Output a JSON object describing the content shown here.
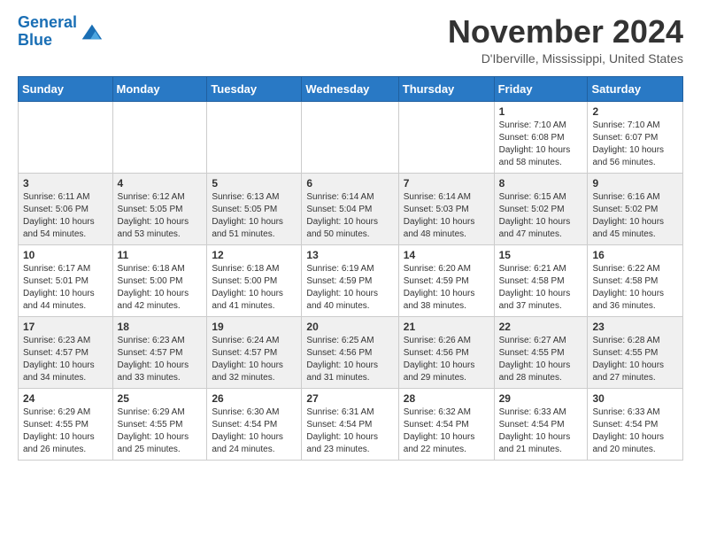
{
  "header": {
    "logo_line1": "General",
    "logo_line2": "Blue",
    "month": "November 2024",
    "location": "D'Iberville, Mississippi, United States"
  },
  "weekdays": [
    "Sunday",
    "Monday",
    "Tuesday",
    "Wednesday",
    "Thursday",
    "Friday",
    "Saturday"
  ],
  "weeks": [
    [
      {
        "day": "",
        "info": ""
      },
      {
        "day": "",
        "info": ""
      },
      {
        "day": "",
        "info": ""
      },
      {
        "day": "",
        "info": ""
      },
      {
        "day": "",
        "info": ""
      },
      {
        "day": "1",
        "info": "Sunrise: 7:10 AM\nSunset: 6:08 PM\nDaylight: 10 hours\nand 58 minutes."
      },
      {
        "day": "2",
        "info": "Sunrise: 7:10 AM\nSunset: 6:07 PM\nDaylight: 10 hours\nand 56 minutes."
      }
    ],
    [
      {
        "day": "3",
        "info": "Sunrise: 6:11 AM\nSunset: 5:06 PM\nDaylight: 10 hours\nand 54 minutes."
      },
      {
        "day": "4",
        "info": "Sunrise: 6:12 AM\nSunset: 5:05 PM\nDaylight: 10 hours\nand 53 minutes."
      },
      {
        "day": "5",
        "info": "Sunrise: 6:13 AM\nSunset: 5:05 PM\nDaylight: 10 hours\nand 51 minutes."
      },
      {
        "day": "6",
        "info": "Sunrise: 6:14 AM\nSunset: 5:04 PM\nDaylight: 10 hours\nand 50 minutes."
      },
      {
        "day": "7",
        "info": "Sunrise: 6:14 AM\nSunset: 5:03 PM\nDaylight: 10 hours\nand 48 minutes."
      },
      {
        "day": "8",
        "info": "Sunrise: 6:15 AM\nSunset: 5:02 PM\nDaylight: 10 hours\nand 47 minutes."
      },
      {
        "day": "9",
        "info": "Sunrise: 6:16 AM\nSunset: 5:02 PM\nDaylight: 10 hours\nand 45 minutes."
      }
    ],
    [
      {
        "day": "10",
        "info": "Sunrise: 6:17 AM\nSunset: 5:01 PM\nDaylight: 10 hours\nand 44 minutes."
      },
      {
        "day": "11",
        "info": "Sunrise: 6:18 AM\nSunset: 5:00 PM\nDaylight: 10 hours\nand 42 minutes."
      },
      {
        "day": "12",
        "info": "Sunrise: 6:18 AM\nSunset: 5:00 PM\nDaylight: 10 hours\nand 41 minutes."
      },
      {
        "day": "13",
        "info": "Sunrise: 6:19 AM\nSunset: 4:59 PM\nDaylight: 10 hours\nand 40 minutes."
      },
      {
        "day": "14",
        "info": "Sunrise: 6:20 AM\nSunset: 4:59 PM\nDaylight: 10 hours\nand 38 minutes."
      },
      {
        "day": "15",
        "info": "Sunrise: 6:21 AM\nSunset: 4:58 PM\nDaylight: 10 hours\nand 37 minutes."
      },
      {
        "day": "16",
        "info": "Sunrise: 6:22 AM\nSunset: 4:58 PM\nDaylight: 10 hours\nand 36 minutes."
      }
    ],
    [
      {
        "day": "17",
        "info": "Sunrise: 6:23 AM\nSunset: 4:57 PM\nDaylight: 10 hours\nand 34 minutes."
      },
      {
        "day": "18",
        "info": "Sunrise: 6:23 AM\nSunset: 4:57 PM\nDaylight: 10 hours\nand 33 minutes."
      },
      {
        "day": "19",
        "info": "Sunrise: 6:24 AM\nSunset: 4:57 PM\nDaylight: 10 hours\nand 32 minutes."
      },
      {
        "day": "20",
        "info": "Sunrise: 6:25 AM\nSunset: 4:56 PM\nDaylight: 10 hours\nand 31 minutes."
      },
      {
        "day": "21",
        "info": "Sunrise: 6:26 AM\nSunset: 4:56 PM\nDaylight: 10 hours\nand 29 minutes."
      },
      {
        "day": "22",
        "info": "Sunrise: 6:27 AM\nSunset: 4:55 PM\nDaylight: 10 hours\nand 28 minutes."
      },
      {
        "day": "23",
        "info": "Sunrise: 6:28 AM\nSunset: 4:55 PM\nDaylight: 10 hours\nand 27 minutes."
      }
    ],
    [
      {
        "day": "24",
        "info": "Sunrise: 6:29 AM\nSunset: 4:55 PM\nDaylight: 10 hours\nand 26 minutes."
      },
      {
        "day": "25",
        "info": "Sunrise: 6:29 AM\nSunset: 4:55 PM\nDaylight: 10 hours\nand 25 minutes."
      },
      {
        "day": "26",
        "info": "Sunrise: 6:30 AM\nSunset: 4:54 PM\nDaylight: 10 hours\nand 24 minutes."
      },
      {
        "day": "27",
        "info": "Sunrise: 6:31 AM\nSunset: 4:54 PM\nDaylight: 10 hours\nand 23 minutes."
      },
      {
        "day": "28",
        "info": "Sunrise: 6:32 AM\nSunset: 4:54 PM\nDaylight: 10 hours\nand 22 minutes."
      },
      {
        "day": "29",
        "info": "Sunrise: 6:33 AM\nSunset: 4:54 PM\nDaylight: 10 hours\nand 21 minutes."
      },
      {
        "day": "30",
        "info": "Sunrise: 6:33 AM\nSunset: 4:54 PM\nDaylight: 10 hours\nand 20 minutes."
      }
    ]
  ]
}
